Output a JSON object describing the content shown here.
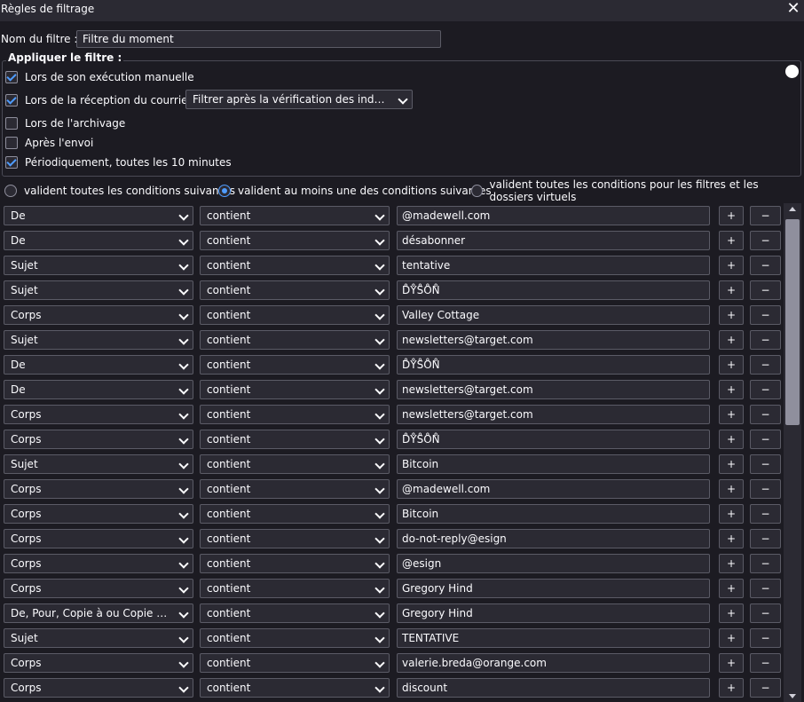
{
  "window": {
    "title": "Règles de filtrage",
    "close_glyph": "✕"
  },
  "filter_name": {
    "label": "Nom du filtre :",
    "value": "Filtre du moment"
  },
  "apply": {
    "legend": "Appliquer le filtre :",
    "options": [
      {
        "label": "Lors de son exécution manuelle",
        "checked": true
      },
      {
        "label": "Lors de la réception du courrier :",
        "checked": true
      },
      {
        "label": "Lors de l'archivage",
        "checked": false
      },
      {
        "label": "Après l'envoi",
        "checked": false
      },
      {
        "label": "Périodiquement, toutes les 10 minutes",
        "checked": true
      }
    ],
    "fetch_select": "Filtrer après la vérification des indésirables"
  },
  "match": {
    "options": [
      {
        "label": "valident toutes les conditions suivantes",
        "selected": false
      },
      {
        "label": "valident au moins une des conditions suivantes",
        "selected": true
      },
      {
        "label": "valident toutes les conditions pour les filtres et les dossiers virtuels",
        "selected": false
      }
    ]
  },
  "rules": [
    {
      "field": "De",
      "op": "contient",
      "value": "@madewell.com"
    },
    {
      "field": "De",
      "op": "contient",
      "value": "désabonner"
    },
    {
      "field": "Sujet",
      "op": "contient",
      "value": "tentative"
    },
    {
      "field": "Sujet",
      "op": "contient",
      "value": "D̊Y̊S̊O̊N̊"
    },
    {
      "field": "Corps",
      "op": "contient",
      "value": "Valley Cottage"
    },
    {
      "field": "Sujet",
      "op": "contient",
      "value": "newsletters@target.com"
    },
    {
      "field": "De",
      "op": "contient",
      "value": "D̊Y̊S̊O̊N̊"
    },
    {
      "field": "De",
      "op": "contient",
      "value": "newsletters@target.com"
    },
    {
      "field": "Corps",
      "op": "contient",
      "value": "newsletters@target.com"
    },
    {
      "field": "Corps",
      "op": "contient",
      "value": "D̊Y̊S̊O̊N̊"
    },
    {
      "field": "Sujet",
      "op": "contient",
      "value": "Bitcoin"
    },
    {
      "field": "Corps",
      "op": "contient",
      "value": "@madewell.com"
    },
    {
      "field": "Corps",
      "op": "contient",
      "value": "Bitcoin"
    },
    {
      "field": "Corps",
      "op": "contient",
      "value": "do-not-reply@esign"
    },
    {
      "field": "Corps",
      "op": "contient",
      "value": "@esign"
    },
    {
      "field": "Corps",
      "op": "contient",
      "value": "Gregory Hind"
    },
    {
      "field": "De, Pour, Copie à ou Copie cach...",
      "op": "contient",
      "value": "Gregory Hind"
    },
    {
      "field": "Sujet",
      "op": "contient",
      "value": "TENTATIVE"
    },
    {
      "field": "Corps",
      "op": "contient",
      "value": "valerie.breda@orange.com"
    },
    {
      "field": "Corps",
      "op": "contient",
      "value": "discount"
    }
  ],
  "buttons": {
    "add": "+",
    "remove": "−"
  },
  "colors": {
    "background": "#1c1b22",
    "field": "#2b2a33",
    "accent": "#4f9cff",
    "text": "#fbfbfe"
  },
  "icons": {
    "close": "close-icon",
    "dropdown": "chevron-down-icon",
    "toggle": "toggle-dot-icon"
  }
}
